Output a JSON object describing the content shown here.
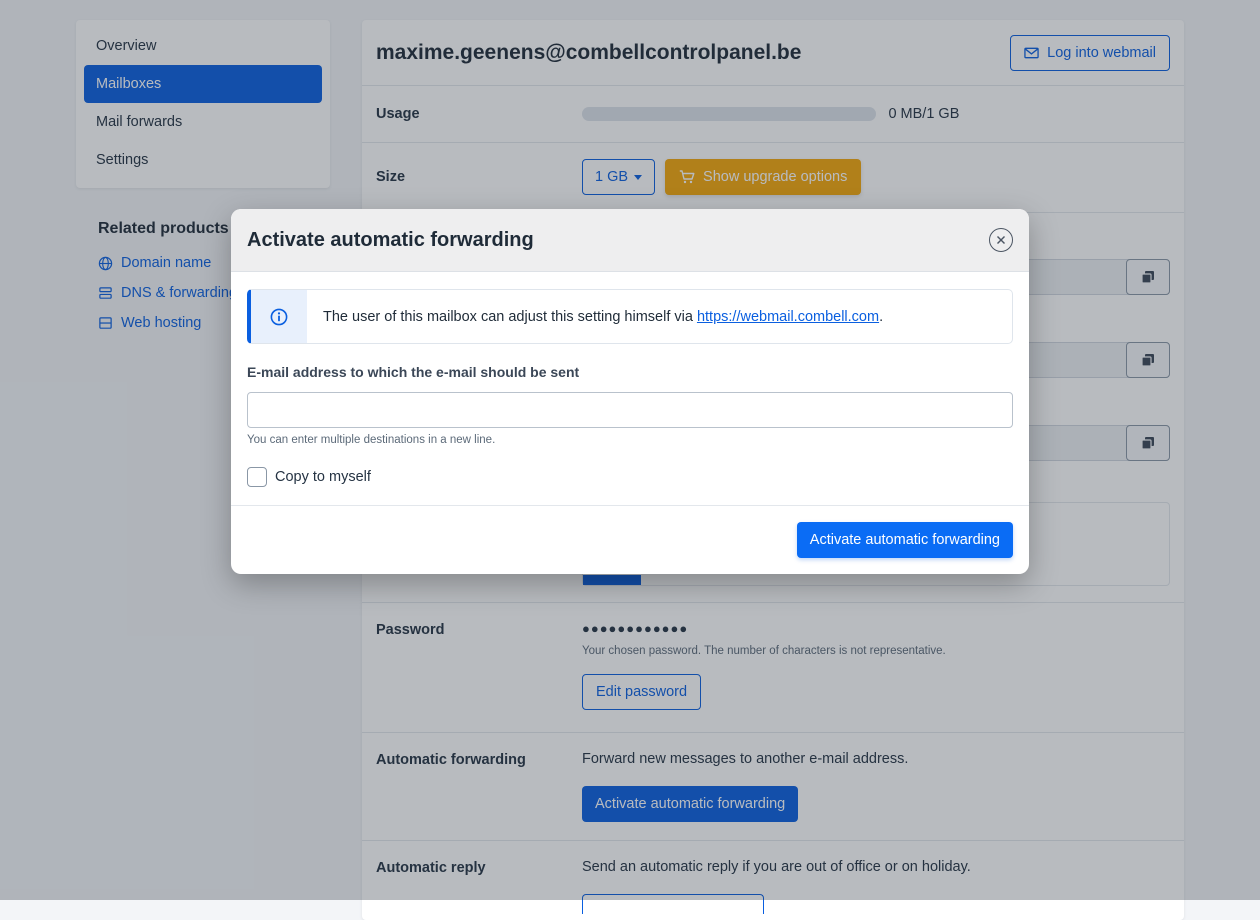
{
  "sidebar": {
    "items": [
      {
        "label": "Overview"
      },
      {
        "label": "Mailboxes"
      },
      {
        "label": "Mail forwards"
      },
      {
        "label": "Settings"
      }
    ]
  },
  "related": {
    "title": "Related products",
    "links": [
      {
        "label": "Domain name",
        "icon": "globe-icon"
      },
      {
        "label": "DNS & forwarding",
        "icon": "server-icon"
      },
      {
        "label": "Web hosting",
        "icon": "hosting-icon"
      }
    ]
  },
  "main": {
    "title": "maxime.geenens@combellcontrolpanel.be",
    "webmail_button": "Log into webmail",
    "usage": {
      "label": "Usage",
      "text": "0 MB/1 GB",
      "fraction": 0
    },
    "size": {
      "label": "Size",
      "value": "1 GB",
      "upgrade_button": "Show upgrade options"
    },
    "password": {
      "label": "Password",
      "masked": "●●●●●●●●●●●●",
      "help": "Your chosen password. The number of characters is not representative.",
      "edit_button": "Edit password"
    },
    "forwarding": {
      "label": "Automatic forwarding",
      "description": "Forward new messages to another e-mail address.",
      "button": "Activate automatic forwarding"
    },
    "reply": {
      "label": "Automatic reply",
      "description": "Send an automatic reply if you are out of office or on holiday."
    }
  },
  "modal": {
    "title": "Activate automatic forwarding",
    "info_prefix": "The user of this mailbox can adjust this setting himself via ",
    "info_link": "https://webmail.combell.com",
    "info_suffix": ".",
    "field_label": "E-mail address to which the e-mail should be sent",
    "field_value": "",
    "field_help": "You can enter multiple destinations in a new line.",
    "checkbox_label": "Copy to myself",
    "checkbox_checked": false,
    "submit_button": "Activate automatic forwarding"
  },
  "colors": {
    "primary": "#0a5fe0",
    "warning": "#f5a70a",
    "overlay": "rgba(40,50,62,0.33)"
  }
}
